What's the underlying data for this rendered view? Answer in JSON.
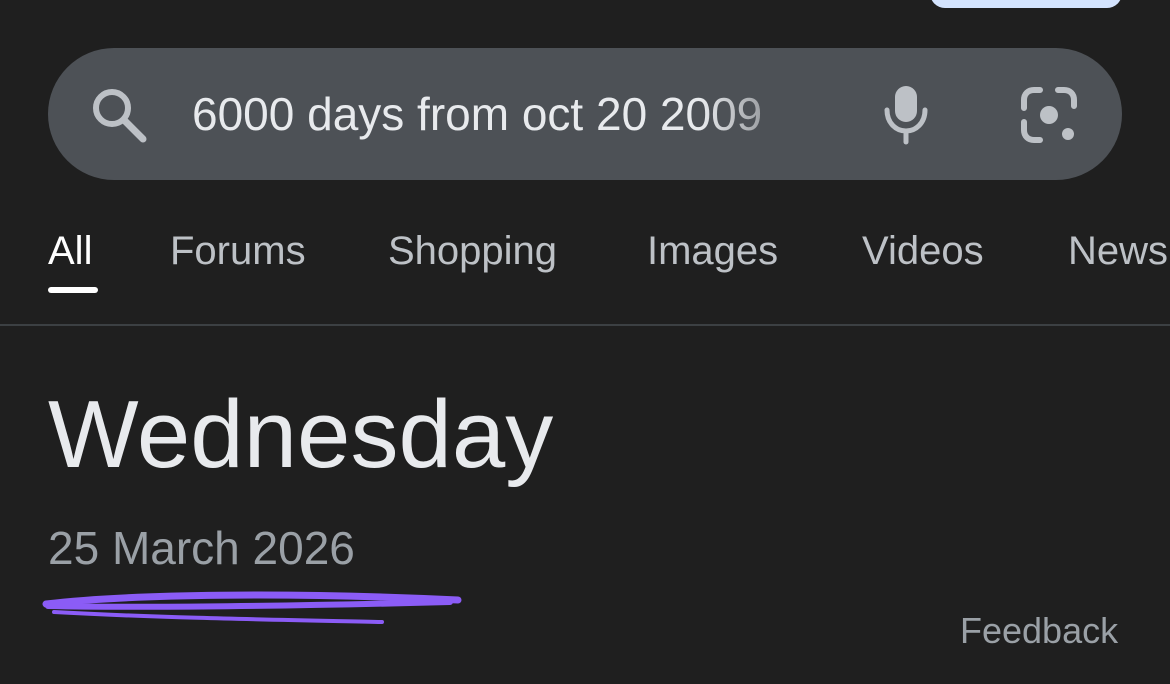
{
  "search": {
    "query": "6000 days from oct 20 2009",
    "icons": {
      "search": "search-icon",
      "voice": "microphone-icon",
      "lens": "camera-lens-icon"
    }
  },
  "tabs": [
    {
      "label": "All",
      "active": true
    },
    {
      "label": "Forums",
      "active": false
    },
    {
      "label": "Shopping",
      "active": false
    },
    {
      "label": "Images",
      "active": false
    },
    {
      "label": "Videos",
      "active": false
    },
    {
      "label": "News",
      "active": false
    }
  ],
  "result": {
    "day": "Wednesday",
    "date": "25 March 2026"
  },
  "feedback_label": "Feedback",
  "colors": {
    "background": "#1f1f1f",
    "search_bar": "#4d5156",
    "highlight_scribble": "#8b5cf6",
    "top_pill": "#d3e3fd"
  }
}
